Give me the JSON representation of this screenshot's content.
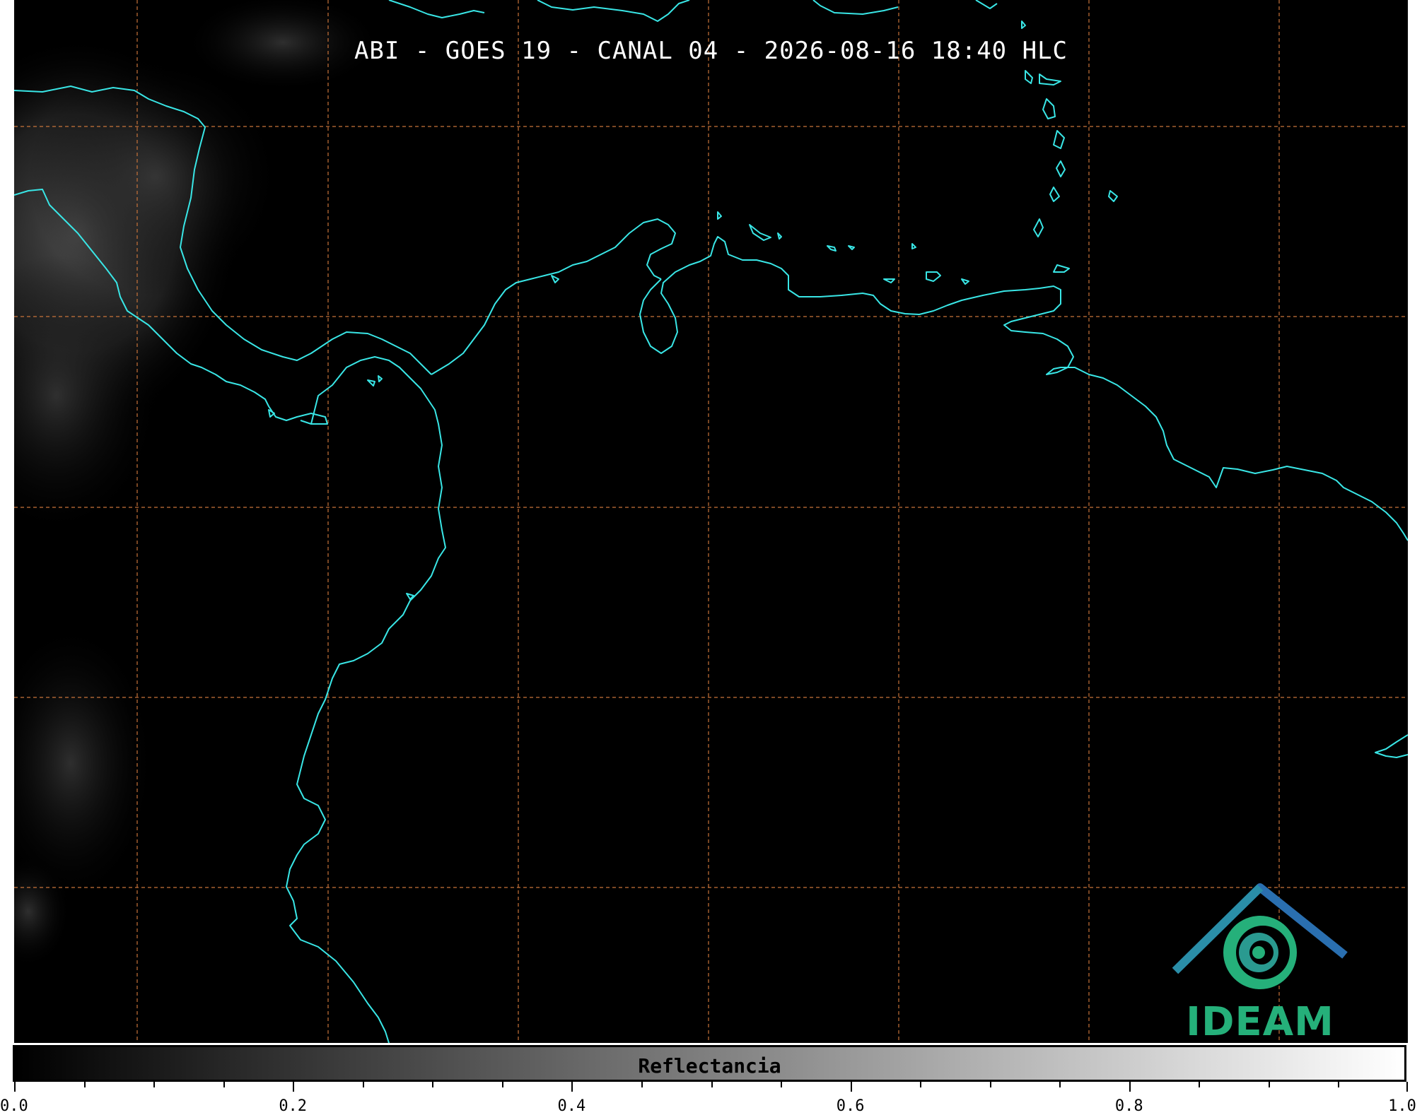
{
  "title": "ABI - GOES 19 - CANAL 04 - 2026-08-16 18:40 HLC",
  "colors": {
    "background": "#000000",
    "coastline": "#39e6e6",
    "grid": "#c8733a",
    "logo_teal": "#25b07a",
    "logo_blue": "#2a6fb0"
  },
  "logo": {
    "text": "IDEAM",
    "icon": "ideam-mountain-spiral-logo"
  },
  "colorbar": {
    "label": "Reflectancia",
    "colormap": "gray",
    "range": [
      0.0,
      1.0
    ],
    "tick_labels": [
      "0.0",
      "0.2",
      "0.4",
      "0.6",
      "0.8",
      "1.0"
    ],
    "tick_values": [
      0.0,
      0.2,
      0.4,
      0.6,
      0.8,
      1.0
    ],
    "minor_step": 0.05
  },
  "map": {
    "gridlines": "dashed",
    "features": [
      "coastlines",
      "country-borders"
    ]
  }
}
